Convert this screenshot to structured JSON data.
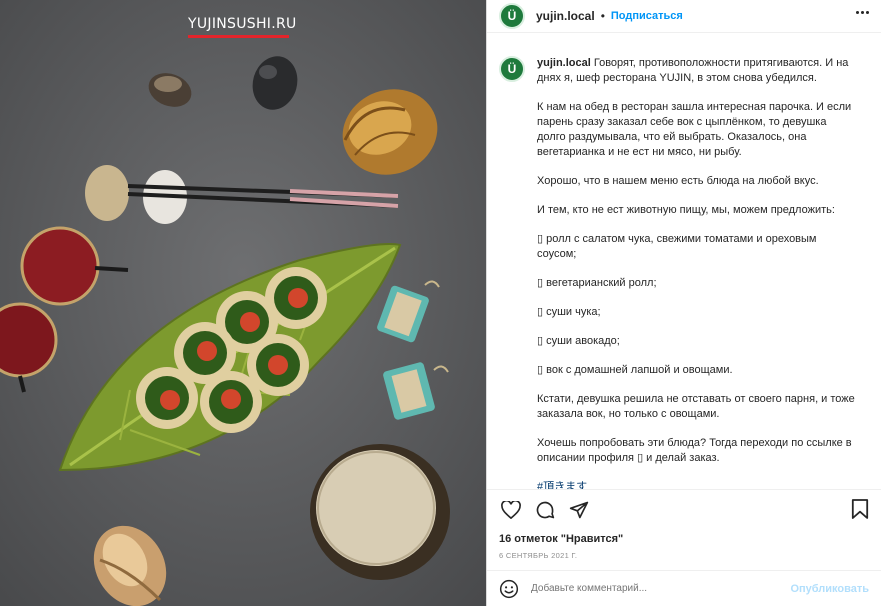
{
  "photo": {
    "watermark": "YUJINSUSHI.RU"
  },
  "header": {
    "avatar_letter": "Ü",
    "username": "yujin.local",
    "separator": "•",
    "follow_label": "Подписаться"
  },
  "caption": {
    "avatar_letter": "Ü",
    "username": "yujin.local",
    "intro": "Говорят, противоположности притягиваются. И на днях я, шеф ресторана YUJIN, в этом снова убедился.",
    "paragraphs": [
      "К нам на обед в ресторан зашла интересная парочка. И если парень сразу заказал себе вок с цыплёнком, то девушка долго раздумывала, что ей выбрать. Оказалось, она вегетарианка и не ест ни мясо, ни рыбу.",
      "Хорошо, что в нашем меню есть блюда на любой вкус.",
      "И тем, кто не ест животную пищу, мы, можем предложить:",
      "▯ ролл с салатом чука, свежими томатами и ореховым соусом;",
      "▯ вегетарианский ролл;",
      "▯ суши чука;",
      "▯ суши авокадо;",
      "▯ вок с домашней лапшой и овощами.",
      "Кстати, девушка решила не отставать от своего парня, и тоже заказала вок, но только с овощами.",
      "Хочешь попробовать эти блюда? Тогда переходи по ссылке в описании профиля ▯ и делай заказ."
    ],
    "hashtag": "#頂きます"
  },
  "actions": {
    "like_icon": "heart-icon",
    "comment_icon": "comment-icon",
    "share_icon": "send-icon",
    "save_icon": "bookmark-icon"
  },
  "likes_text": "16 отметок \"Нравится\"",
  "date_text": "6 СЕНТЯБРЬ 2021 Г.",
  "comment_box": {
    "placeholder": "Добавьте комментарий...",
    "post_label": "Опубликовать"
  }
}
